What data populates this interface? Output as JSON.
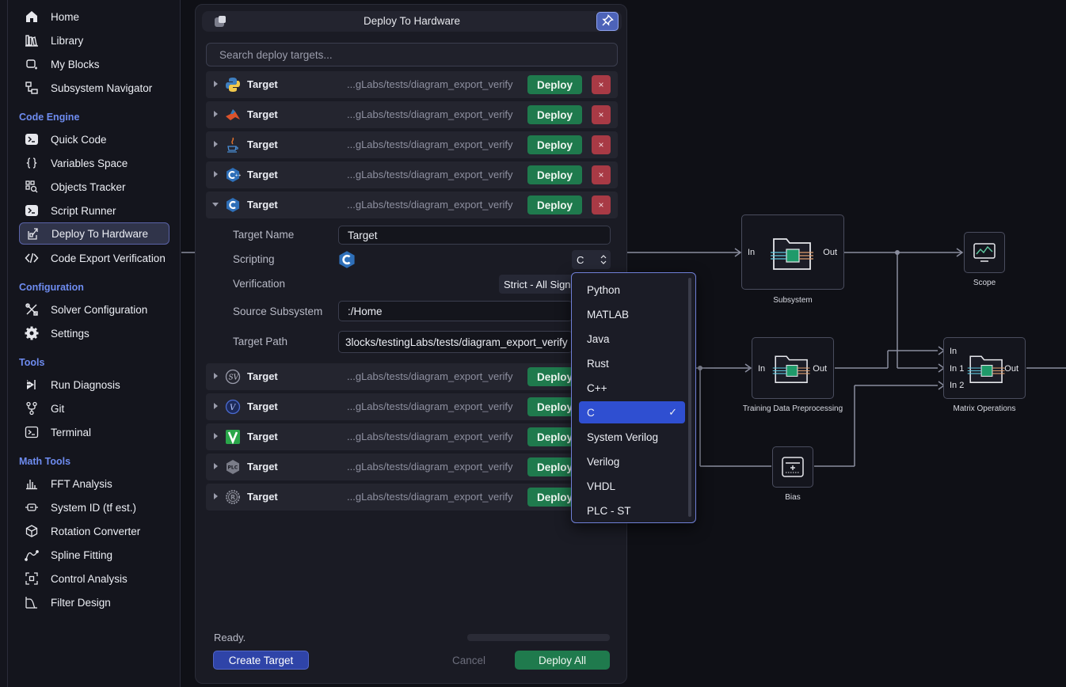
{
  "sidebar": {
    "top_items": [
      {
        "label": "Home",
        "icon": "home-icon"
      },
      {
        "label": "Library",
        "icon": "library-icon"
      },
      {
        "label": "My Blocks",
        "icon": "blocks-icon"
      },
      {
        "label": "Subsystem Navigator",
        "icon": "navigator-icon"
      }
    ],
    "sections": [
      {
        "title": "Code Engine",
        "items": [
          {
            "label": "Quick Code",
            "icon": "terminal-icon"
          },
          {
            "label": "Variables Space",
            "icon": "braces-icon"
          },
          {
            "label": "Objects Tracker",
            "icon": "search-grid-icon"
          },
          {
            "label": "Script Runner",
            "icon": "terminal-icon"
          },
          {
            "label": "Deploy To Hardware",
            "icon": "deploy-icon"
          },
          {
            "label": "Code Export Verification",
            "icon": "code-icon"
          }
        ]
      },
      {
        "title": "Configuration",
        "items": [
          {
            "label": "Solver Configuration",
            "icon": "tools-icon"
          },
          {
            "label": "Settings",
            "icon": "gear-icon"
          }
        ]
      },
      {
        "title": "Tools",
        "items": [
          {
            "label": "Run Diagnosis",
            "icon": "diagnosis-icon"
          },
          {
            "label": "Git",
            "icon": "git-icon"
          },
          {
            "label": "Terminal",
            "icon": "terminal-icon"
          }
        ]
      },
      {
        "title": "Math Tools",
        "items": [
          {
            "label": "FFT Analysis",
            "icon": "fft-icon"
          },
          {
            "label": "System ID (tf est.)",
            "icon": "system-id-icon"
          },
          {
            "label": "Rotation Converter",
            "icon": "cube-icon"
          },
          {
            "label": "Spline Fitting",
            "icon": "spline-icon"
          },
          {
            "label": "Control Analysis",
            "icon": "control-icon"
          },
          {
            "label": "Filter Design",
            "icon": "filter-icon"
          }
        ]
      }
    ]
  },
  "dialog": {
    "title": "Deploy To Hardware",
    "search_placeholder": "Search deploy targets...",
    "deploy_label": "Deploy",
    "delete_label": "×",
    "targets": [
      {
        "name": "Target",
        "path": "...gLabs/tests/diagram_export_verify",
        "icon": "python-icon"
      },
      {
        "name": "Target",
        "path": "...gLabs/tests/diagram_export_verify",
        "icon": "matlab-icon"
      },
      {
        "name": "Target",
        "path": "...gLabs/tests/diagram_export_verify",
        "icon": "java-icon"
      },
      {
        "name": "Target",
        "path": "...gLabs/tests/diagram_export_verify",
        "icon": "cpp-icon"
      },
      {
        "name": "Target",
        "path": "...gLabs/tests/diagram_export_verify",
        "icon": "c-icon"
      },
      {
        "name": "Target",
        "path": "...gLabs/tests/diagram_export_verify",
        "icon": "systemverilog-icon"
      },
      {
        "name": "Target",
        "path": "...gLabs/tests/diagram_export_verify",
        "icon": "verilog-icon"
      },
      {
        "name": "Target",
        "path": "...gLabs/tests/diagram_export_verify",
        "icon": "vhdl-icon"
      },
      {
        "name": "Target",
        "path": "...gLabs/tests/diagram_export_verify",
        "icon": "plc-icon"
      },
      {
        "name": "Target",
        "path": "...gLabs/tests/diagram_export_verify",
        "icon": "rust-icon"
      }
    ],
    "detail": {
      "target_name_label": "Target Name",
      "target_name_value": "Target",
      "scripting_label": "Scripting",
      "scripting_value": "C",
      "verification_label": "Verification",
      "verification_value": "Strict - All Signa",
      "source_label": "Source Subsystem",
      "source_value": ":/Home",
      "path_label": "Target Path",
      "path_value": "3locks/testingLabs/tests/diagram_export_verify"
    },
    "status": "Ready.",
    "progress": 0,
    "create_label": "Create Target",
    "cancel_label": "Cancel",
    "deploy_all_label": "Deploy All"
  },
  "language_dropdown": {
    "options": [
      "Python",
      "MATLAB",
      "Java",
      "Rust",
      "C++",
      "C",
      "System Verilog",
      "Verilog",
      "VHDL",
      "PLC - ST"
    ],
    "selected": "C",
    "check": "✓"
  },
  "canvas": {
    "blocks": [
      {
        "label": "Subsystem",
        "in": "In",
        "out": "Out"
      },
      {
        "label": "Scope"
      },
      {
        "label": "Training Data Preprocessing",
        "in": "In",
        "out": "Out"
      },
      {
        "label": "Matrix Operations",
        "in": "In",
        "in1": "In 1",
        "in2": "In 2",
        "out": "Out"
      },
      {
        "label": "Bias"
      }
    ]
  },
  "colors": {
    "accent": "#6e8cf0",
    "deploy_green": "#1f7a4d",
    "delete_red": "#a83a45",
    "selected": "#2f4fd1"
  }
}
